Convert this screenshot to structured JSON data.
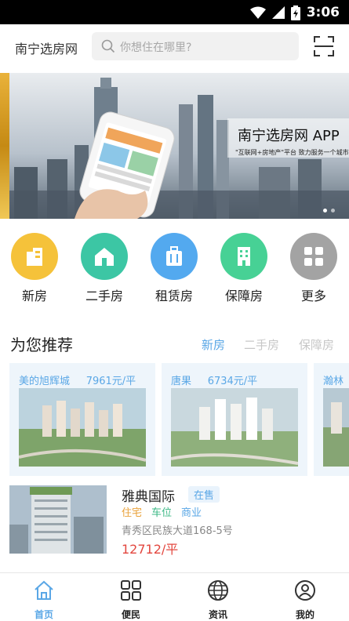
{
  "status_bar": {
    "time": "3:06",
    "icons": [
      "wifi-icon",
      "signal-icon",
      "battery-charging-icon"
    ]
  },
  "header": {
    "brand": "南宁选房网",
    "search_placeholder": "你想住在哪里?",
    "scan_icon": "scan-icon"
  },
  "banner": {
    "title": "南宁选房网 APP",
    "subtitle": "\"互联网+房地产\"平台   致力服务一个城市"
  },
  "categories": [
    {
      "label": "新房",
      "icon": "building-icon",
      "color": "#f5c23a"
    },
    {
      "label": "二手房",
      "icon": "house-icon",
      "color": "#3cc6a4"
    },
    {
      "label": "租赁房",
      "icon": "suitcase-icon",
      "color": "#53a9ef"
    },
    {
      "label": "保障房",
      "icon": "apartment-icon",
      "color": "#47d195"
    },
    {
      "label": "更多",
      "icon": "grid-icon",
      "color": "#a3a3a3"
    }
  ],
  "recommend": {
    "title": "为您推荐",
    "tabs": [
      "新房",
      "二手房",
      "保障房"
    ],
    "active_tab": "新房"
  },
  "cards": [
    {
      "name": "美的旭辉城",
      "price": "7961元/平"
    },
    {
      "name": "唐果",
      "price": "6734元/平"
    },
    {
      "name": "瀚林",
      "price": ""
    }
  ],
  "listing": {
    "name": "雅典国际",
    "status": "在售",
    "tags": [
      "住宅",
      "车位",
      "商业"
    ],
    "tag_colors": [
      "#e9a23b",
      "#3db886",
      "#5aa7e6"
    ],
    "address": "青秀区民族大道168-5号",
    "price": "12712/平"
  },
  "bottom_nav": [
    {
      "label": "首页",
      "icon": "home-icon",
      "active": true
    },
    {
      "label": "便民",
      "icon": "grid-icon"
    },
    {
      "label": "资讯",
      "icon": "globe-icon"
    },
    {
      "label": "我的",
      "icon": "user-icon"
    }
  ],
  "colors": {
    "accent": "#5aa7e6",
    "price": "#e3473f"
  }
}
